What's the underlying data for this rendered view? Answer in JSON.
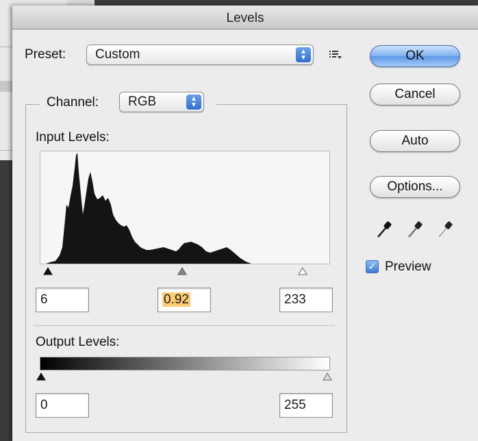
{
  "window": {
    "title": "Levels"
  },
  "preset": {
    "label": "Preset:",
    "value": "Custom"
  },
  "channel": {
    "label": "Channel:",
    "value": "RGB"
  },
  "input_levels": {
    "label": "Input Levels:",
    "shadow": "6",
    "midtone": "0.92",
    "highlight": "233"
  },
  "output_levels": {
    "label": "Output Levels:",
    "shadow": "0",
    "highlight": "255"
  },
  "buttons": {
    "ok": "OK",
    "cancel": "Cancel",
    "auto": "Auto",
    "options": "Options..."
  },
  "preview": {
    "label": "Preview",
    "checked": true
  },
  "icons": {
    "preset_menu": "list-menu-icon",
    "eyedroppers": [
      "black-point-eyedropper-icon",
      "gray-point-eyedropper-icon",
      "white-point-eyedropper-icon"
    ]
  },
  "colors": {
    "accent": "#5c97e6",
    "selection": "#fbcc74",
    "dialog_bg": "#ececec"
  }
}
